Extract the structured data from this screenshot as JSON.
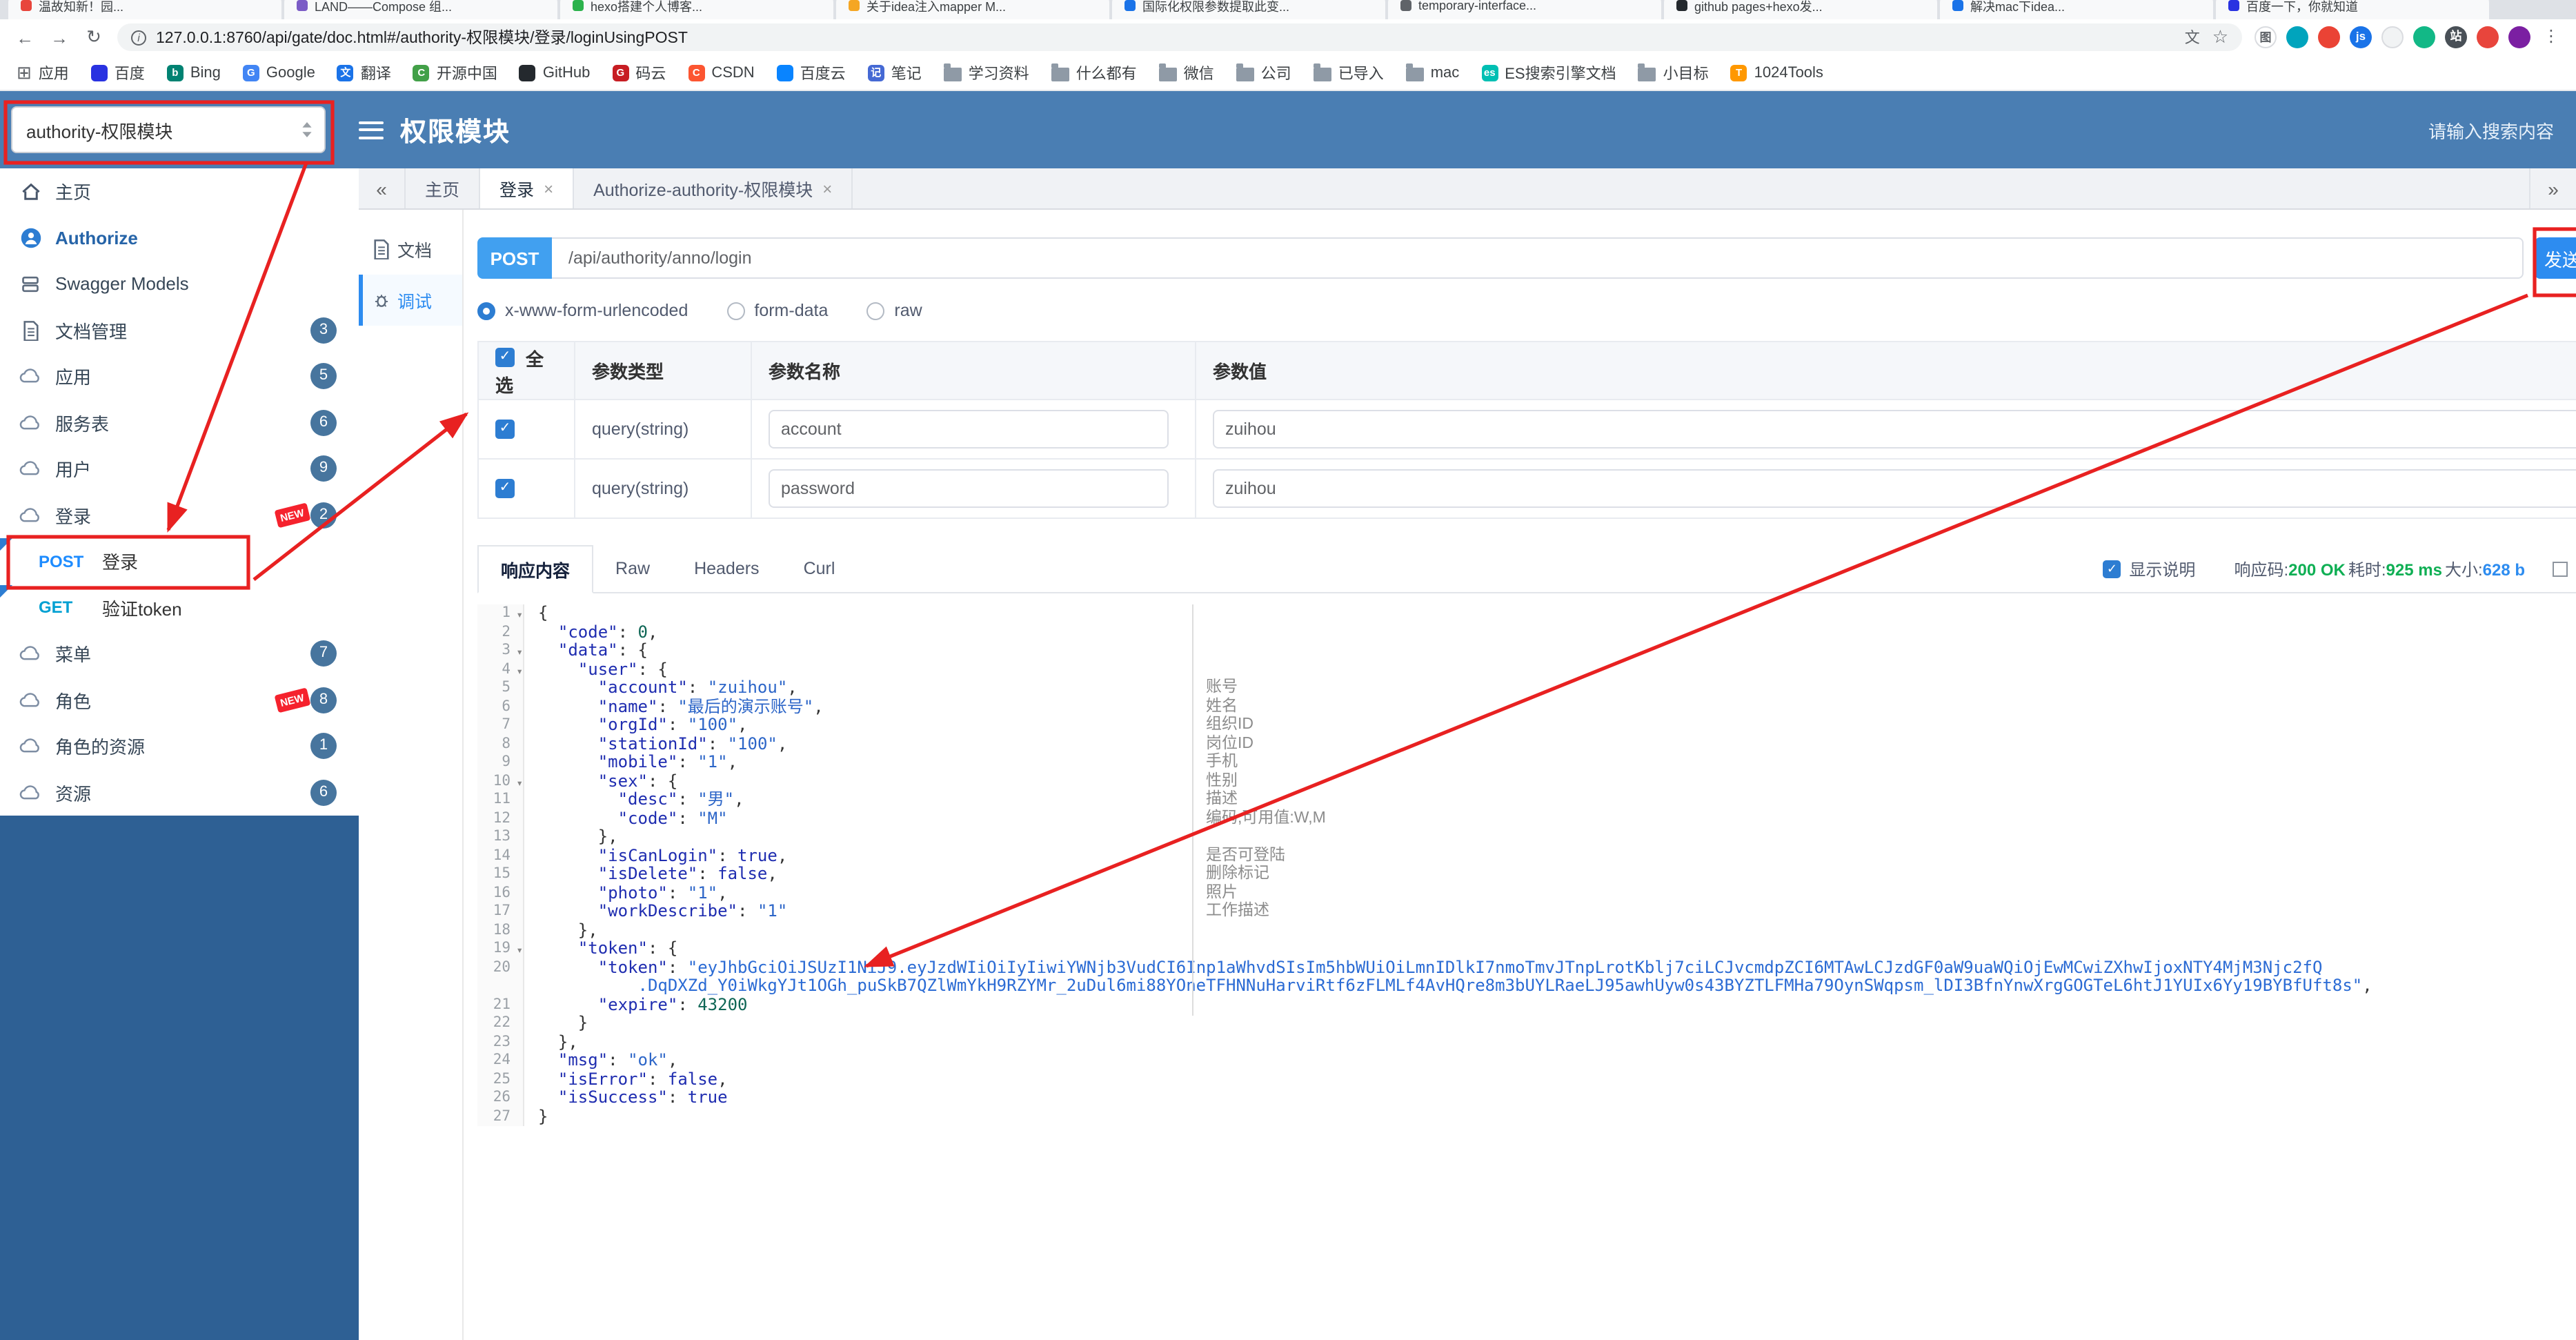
{
  "browser": {
    "tabs": [
      {
        "title": "温故知新！园...",
        "color": "#e8453c"
      },
      {
        "title": "LAND——Compose 组...",
        "color": "#7b5cc6"
      },
      {
        "title": "hexo搭建个人博客...",
        "color": "#2bb24c"
      },
      {
        "title": "关于idea注入mapper M...",
        "color": "#f5a623"
      },
      {
        "title": "国际化权限参数提取此变...",
        "color": "#1a73e8"
      },
      {
        "title": "temporary-interface...",
        "color": "#5f6368"
      },
      {
        "title": "github pages+hexo发...",
        "color": "#24292e"
      },
      {
        "title": "解决mac下idea...",
        "color": "#1a73e8"
      },
      {
        "title": "百度一下，你就知道",
        "color": "#2932e1"
      }
    ],
    "url": "127.0.0.1:8760/api/gate/doc.html#/authority-权限模块/登录/loginUsingPOST",
    "action_icons": [
      {
        "name": "extension-icon-1",
        "glyph": "图",
        "bg": "#ffffff",
        "fg": "#5f6368",
        "border": true
      },
      {
        "name": "extension-icon-2",
        "glyph": "",
        "bg": "#00a4bd",
        "fg": "#ffffff"
      },
      {
        "name": "extension-icon-3",
        "glyph": "",
        "bg": "#ea4335",
        "fg": "#ffffff"
      },
      {
        "name": "extension-icon-4",
        "glyph": "js",
        "bg": "#1a73e8",
        "fg": "#ffffff"
      },
      {
        "name": "extension-icon-5",
        "glyph": "",
        "bg": "#f1f3f4",
        "fg": "#5f6368",
        "border": true
      },
      {
        "name": "extension-icon-6",
        "glyph": "",
        "bg": "#12b886",
        "fg": "#ffffff"
      },
      {
        "name": "extension-icon-7",
        "glyph": "站",
        "bg": "#495057",
        "fg": "#ffffff"
      },
      {
        "name": "extension-icon-8",
        "glyph": "",
        "bg": "#e8453c",
        "fg": "#ffffff"
      },
      {
        "name": "profile-avatar",
        "glyph": "",
        "bg": "#7b1fa2",
        "fg": "#ffffff"
      },
      {
        "name": "menu-kebab-icon",
        "glyph": "⋮",
        "bg": "transparent",
        "fg": "#5f6368"
      }
    ],
    "bookmarks": [
      {
        "label": "应用",
        "kind": "apps"
      },
      {
        "label": "百度",
        "kind": "site",
        "color": "#2932e1"
      },
      {
        "label": "Bing",
        "kind": "site",
        "color": "#008272",
        "letter": "b"
      },
      {
        "label": "Google",
        "kind": "site",
        "color": "#4285f4",
        "letter": "G"
      },
      {
        "label": "翻译",
        "kind": "site",
        "color": "#1a73e8",
        "letter": "文"
      },
      {
        "label": "开源中国",
        "kind": "site",
        "color": "#42a048",
        "letter": "C"
      },
      {
        "label": "GitHub",
        "kind": "site",
        "color": "#24292e"
      },
      {
        "label": "码云",
        "kind": "site",
        "color": "#c71d23",
        "letter": "G"
      },
      {
        "label": "CSDN",
        "kind": "site",
        "color": "#fc5531",
        "letter": "C"
      },
      {
        "label": "百度云",
        "kind": "site",
        "color": "#0984ff"
      },
      {
        "label": "笔记",
        "kind": "site",
        "color": "#4569d4",
        "letter": "记"
      },
      {
        "label": "学习资料",
        "kind": "folder"
      },
      {
        "label": "什么都有",
        "kind": "folder"
      },
      {
        "label": "微信",
        "kind": "folder"
      },
      {
        "label": "公司",
        "kind": "folder"
      },
      {
        "label": "已导入",
        "kind": "folder"
      },
      {
        "label": "mac",
        "kind": "folder"
      },
      {
        "label": "ES搜索引擎文档",
        "kind": "site",
        "color": "#00bfb3",
        "letter": "es"
      },
      {
        "label": "小目标",
        "kind": "folder"
      },
      {
        "label": "1024Tools",
        "kind": "site",
        "color": "#ff9800",
        "letter": "T"
      }
    ]
  },
  "icons": {
    "back": "←",
    "forward": "→",
    "reload": "↻",
    "info": "i",
    "translate": "文",
    "star": "☆",
    "apps": "⊞",
    "collapse": "«",
    "expand": "»",
    "close": "×",
    "check": "✓",
    "fold": "▾",
    "kebab": "⋮"
  },
  "header": {
    "project_select": "authority-权限模块",
    "title": "权限模块",
    "search_placeholder": "请输入搜索内容"
  },
  "sidebar": {
    "new_label": "NEW",
    "items": [
      {
        "label": "主页",
        "icon": "home"
      },
      {
        "label": "Authorize",
        "icon": "authorize",
        "emphasis": true
      },
      {
        "label": "Swagger Models",
        "icon": "models"
      },
      {
        "label": "文档管理",
        "icon": "document",
        "badge": "3"
      },
      {
        "label": "应用",
        "icon": "cloud",
        "badge": "5"
      },
      {
        "label": "服务表",
        "icon": "cloud",
        "badge": "6"
      },
      {
        "label": "用户",
        "icon": "cloud",
        "badge": "9"
      },
      {
        "label": "登录",
        "icon": "cloud",
        "badge": "2",
        "isNew": true
      },
      {
        "method": "POST",
        "label": "登录"
      },
      {
        "method": "GET",
        "label": "验证token"
      },
      {
        "label": "菜单",
        "icon": "cloud",
        "badge": "7"
      },
      {
        "label": "角色",
        "icon": "cloud",
        "badge": "8",
        "isNew": true
      },
      {
        "label": "角色的资源",
        "icon": "cloud",
        "badge": "1"
      },
      {
        "label": "资源",
        "icon": "cloud",
        "badge": "6"
      }
    ]
  },
  "main": {
    "tabs": [
      {
        "label": "主页",
        "closable": false,
        "active": false
      },
      {
        "label": "登录",
        "closable": true,
        "active": true
      },
      {
        "label": "Authorize-authority-权限模块",
        "closable": true,
        "active": false
      }
    ],
    "doc_nav": [
      {
        "label": "文档",
        "icon": "document",
        "name": "docnav-item-document",
        "active": false
      },
      {
        "label": "调试",
        "icon": "debug",
        "name": "docnav-item-debug",
        "active": true
      }
    ]
  },
  "request": {
    "method": "POST",
    "path": "/api/authority/anno/login",
    "send_label": "发送",
    "content_types": [
      {
        "label": "x-www-form-urlencoded",
        "selected": true
      },
      {
        "label": "form-data",
        "selected": false
      },
      {
        "label": "raw",
        "selected": false
      }
    ]
  },
  "params": {
    "columns": [
      "全选",
      "参数类型",
      "参数名称",
      "参数值"
    ],
    "rows": [
      {
        "type": "query(string)",
        "name": "account",
        "value": "zuihou"
      },
      {
        "type": "query(string)",
        "name": "password",
        "value": "zuihou"
      }
    ]
  },
  "response": {
    "tabs": [
      {
        "label": "响应内容",
        "active": true
      },
      {
        "label": "Raw",
        "active": false
      },
      {
        "label": "Headers",
        "active": false
      },
      {
        "label": "Curl",
        "active": false
      }
    ],
    "show_desc": "显示说明",
    "meta": [
      {
        "label": "响应码:",
        "value": "200 OK",
        "color": "#0faf54"
      },
      {
        "label": "耗时:",
        "value": "925 ms",
        "color": "#0faf54"
      },
      {
        "label": "大小:",
        "value": "628 b",
        "color": "#2d8cf0"
      }
    ]
  },
  "code": {
    "lines": [
      [
        1,
        true,
        [
          [
            "p",
            "{"
          ]
        ]
      ],
      [
        2,
        false,
        [
          [
            "p",
            "  "
          ],
          [
            "k",
            "\"code\""
          ],
          [
            "p",
            ": "
          ],
          [
            "num",
            "0"
          ],
          [
            "p",
            ","
          ]
        ]
      ],
      [
        3,
        true,
        [
          [
            "p",
            "  "
          ],
          [
            "k",
            "\"data\""
          ],
          [
            "p",
            ": {"
          ]
        ]
      ],
      [
        4,
        true,
        [
          [
            "p",
            "    "
          ],
          [
            "k",
            "\"user\""
          ],
          [
            "p",
            ": {"
          ]
        ]
      ],
      [
        5,
        false,
        [
          [
            "p",
            "      "
          ],
          [
            "k",
            "\"account\""
          ],
          [
            "p",
            ": "
          ],
          [
            "s",
            "\"zuihou\""
          ],
          [
            "p",
            ","
          ]
        ]
      ],
      [
        6,
        false,
        [
          [
            "p",
            "      "
          ],
          [
            "k",
            "\"name\""
          ],
          [
            "p",
            ": "
          ],
          [
            "s",
            "\"最后的演示账号\""
          ],
          [
            "p",
            ","
          ]
        ]
      ],
      [
        7,
        false,
        [
          [
            "p",
            "      "
          ],
          [
            "k",
            "\"orgId\""
          ],
          [
            "p",
            ": "
          ],
          [
            "s",
            "\"100\""
          ],
          [
            "p",
            ","
          ]
        ]
      ],
      [
        8,
        false,
        [
          [
            "p",
            "      "
          ],
          [
            "k",
            "\"stationId\""
          ],
          [
            "p",
            ": "
          ],
          [
            "s",
            "\"100\""
          ],
          [
            "p",
            ","
          ]
        ]
      ],
      [
        9,
        false,
        [
          [
            "p",
            "      "
          ],
          [
            "k",
            "\"mobile\""
          ],
          [
            "p",
            ": "
          ],
          [
            "s",
            "\"1\""
          ],
          [
            "p",
            ","
          ]
        ]
      ],
      [
        10,
        true,
        [
          [
            "p",
            "      "
          ],
          [
            "k",
            "\"sex\""
          ],
          [
            "p",
            ": {"
          ]
        ]
      ],
      [
        11,
        false,
        [
          [
            "p",
            "        "
          ],
          [
            "k",
            "\"desc\""
          ],
          [
            "p",
            ": "
          ],
          [
            "s",
            "\"男\""
          ],
          [
            "p",
            ","
          ]
        ]
      ],
      [
        12,
        false,
        [
          [
            "p",
            "        "
          ],
          [
            "k",
            "\"code\""
          ],
          [
            "p",
            ": "
          ],
          [
            "s",
            "\"M\""
          ]
        ]
      ],
      [
        13,
        false,
        [
          [
            "p",
            "      },"
          ]
        ]
      ],
      [
        14,
        false,
        [
          [
            "p",
            "      "
          ],
          [
            "k",
            "\"isCanLogin\""
          ],
          [
            "p",
            ": "
          ],
          [
            "bool",
            "true"
          ],
          [
            "p",
            ","
          ]
        ]
      ],
      [
        15,
        false,
        [
          [
            "p",
            "      "
          ],
          [
            "k",
            "\"isDelete\""
          ],
          [
            "p",
            ": "
          ],
          [
            "bool",
            "false"
          ],
          [
            "p",
            ","
          ]
        ]
      ],
      [
        16,
        false,
        [
          [
            "p",
            "      "
          ],
          [
            "k",
            "\"photo\""
          ],
          [
            "p",
            ": "
          ],
          [
            "s",
            "\"1\""
          ],
          [
            "p",
            ","
          ]
        ]
      ],
      [
        17,
        false,
        [
          [
            "p",
            "      "
          ],
          [
            "k",
            "\"workDescribe\""
          ],
          [
            "p",
            ": "
          ],
          [
            "s",
            "\"1\""
          ]
        ]
      ],
      [
        18,
        false,
        [
          [
            "p",
            "    },"
          ]
        ]
      ],
      [
        19,
        true,
        [
          [
            "p",
            "    "
          ],
          [
            "k",
            "\"token\""
          ],
          [
            "p",
            ": {"
          ]
        ]
      ],
      [
        20,
        false,
        [
          [
            "p",
            "      "
          ],
          [
            "k",
            "\"token\""
          ],
          [
            "p",
            ": "
          ],
          [
            "tok",
            "\"eyJhbGciOiJSUzI1NiJ9.eyJzdWIiOiIyIiwiYWNjb3VudCI6Inp1aWhvdSIsIm5hbWUiOiLmnIDlkI7nmoTmvJTnpLrotKblj7ciLCJvcmdpZCI6MTAwLCJzdGF0aW9uaWQiOjEwMCwiZXhwIjoxNTY4MjM3Njc2fQ"
          ]
        ]
      ],
      [
        null,
        false,
        [
          [
            "p",
            "          "
          ],
          [
            "tok",
            ".DqDXZd_Y0iWkgYJt1OGh_puSkB7QZlWmYkH9RZYMr_2uDul6mi88YOneTFHNNuHarviRtf6zFLMLf4AvHQre8m3bUYLRaeLJ95awhUyw0s43BYZTLFMHa79OynSWqpsm_lDI3BfnYnwXrgGOGTeL6htJ1YUIx6Yy19BYBfUft8s\""
          ],
          [
            "p",
            ","
          ]
        ]
      ],
      [
        21,
        false,
        [
          [
            "p",
            "      "
          ],
          [
            "k",
            "\"expire\""
          ],
          [
            "p",
            ": "
          ],
          [
            "num",
            "43200"
          ]
        ]
      ],
      [
        22,
        false,
        [
          [
            "p",
            "    }"
          ]
        ]
      ],
      [
        23,
        false,
        [
          [
            "p",
            "  },"
          ]
        ]
      ],
      [
        24,
        false,
        [
          [
            "p",
            "  "
          ],
          [
            "k",
            "\"msg\""
          ],
          [
            "p",
            ": "
          ],
          [
            "s",
            "\"ok\""
          ],
          [
            "p",
            ","
          ]
        ]
      ],
      [
        25,
        false,
        [
          [
            "p",
            "  "
          ],
          [
            "k",
            "\"isError\""
          ],
          [
            "p",
            ": "
          ],
          [
            "bool",
            "false"
          ],
          [
            "p",
            ","
          ]
        ]
      ],
      [
        26,
        false,
        [
          [
            "p",
            "  "
          ],
          [
            "k",
            "\"isSuccess\""
          ],
          [
            "p",
            ": "
          ],
          [
            "bool",
            "true"
          ]
        ]
      ],
      [
        27,
        false,
        [
          [
            "p",
            "}"
          ]
        ]
      ]
    ],
    "notes": [
      {
        "line": 5,
        "text": "账号"
      },
      {
        "line": 6,
        "text": "姓名"
      },
      {
        "line": 7,
        "text": "组织ID"
      },
      {
        "line": 8,
        "text": "岗位ID"
      },
      {
        "line": 9,
        "text": "手机"
      },
      {
        "line": 10,
        "text": "性别"
      },
      {
        "line": 11,
        "text": "描述"
      },
      {
        "line": 12,
        "text": "编码,可用值:W,M"
      },
      {
        "line": 14,
        "text": "是否可登陆"
      },
      {
        "line": 15,
        "text": "删除标记"
      },
      {
        "line": 16,
        "text": "照片"
      },
      {
        "line": 17,
        "text": "工作描述"
      }
    ]
  },
  "colors": {
    "accent": "#2d8cf0",
    "header_bar": "#4a7eb3",
    "sidebar_fill": "#2e6094",
    "annotation": "#e82121",
    "method_badge": "#41a0f0"
  }
}
